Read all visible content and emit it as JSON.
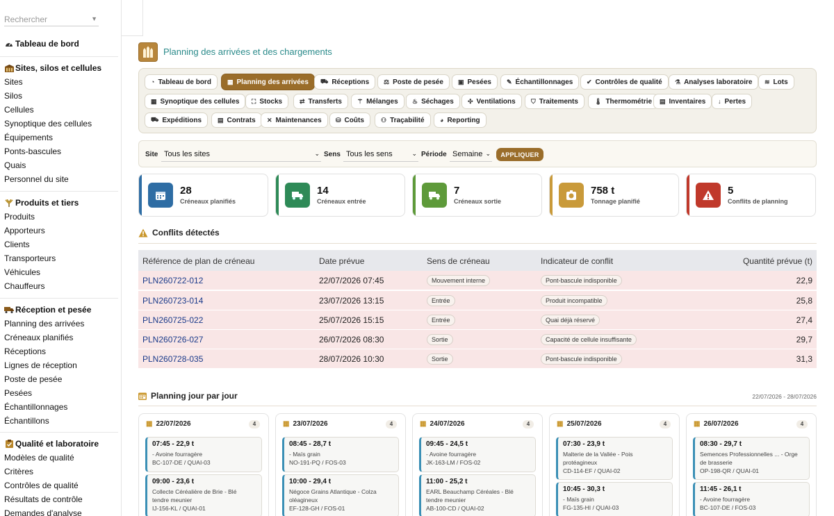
{
  "search": {
    "placeholder": "Rechercher"
  },
  "sidebar": {
    "sections": [
      {
        "title": "Tableau de bord",
        "items": []
      },
      {
        "title": "Sites, silos et cellules",
        "items": [
          "Sites",
          "Silos",
          "Cellules",
          "Synoptique des cellules",
          "Équipements",
          "Ponts-bascules",
          "Quais",
          "Personnel du site"
        ]
      },
      {
        "title": "Produits et tiers",
        "items": [
          "Produits",
          "Apporteurs",
          "Clients",
          "Transporteurs",
          "Véhicules",
          "Chauffeurs"
        ]
      },
      {
        "title": "Réception et pesée",
        "items": [
          "Planning des arrivées",
          "Créneaux planifiés",
          "Réceptions",
          "Lignes de réception",
          "Poste de pesée",
          "Pesées",
          "Échantillonnages",
          "Échantillons"
        ]
      },
      {
        "title": "Qualité et laboratoire",
        "items": [
          "Modèles de qualité",
          "Critères",
          "Contrôles de qualité",
          "Résultats de contrôle",
          "Demandes d'analyse"
        ]
      }
    ]
  },
  "page": {
    "title": "Planning des arrivées et des chargements"
  },
  "tabs": [
    {
      "label": "Tableau de bord",
      "icon": "gauge-icon"
    },
    {
      "label": "Planning des arrivées",
      "icon": "calendar-icon",
      "active": true
    },
    {
      "label": "Réceptions",
      "icon": "truck-icon"
    },
    {
      "label": "Poste de pesée",
      "icon": "scale-icon"
    },
    {
      "label": "Pesées",
      "icon": "weight-icon"
    },
    {
      "label": "Échantillonnages",
      "icon": "pipette-icon"
    },
    {
      "label": "Contrôles de qualité",
      "icon": "check-icon"
    },
    {
      "label": "Analyses laboratoire",
      "icon": "flask-icon"
    },
    {
      "label": "Lots",
      "icon": "layers-icon"
    },
    {
      "label": "Synoptique des cellules",
      "icon": "grid-icon"
    },
    {
      "label": "Stocks",
      "icon": "boxes-icon"
    },
    {
      "label": "Transferts",
      "icon": "shuffle-icon"
    },
    {
      "label": "Mélanges",
      "icon": "blend-icon"
    },
    {
      "label": "Séchages",
      "icon": "flame-icon"
    },
    {
      "label": "Ventilations",
      "icon": "fan-icon"
    },
    {
      "label": "Traitements",
      "icon": "shield-icon"
    },
    {
      "label": "Thermométrie",
      "icon": "thermometer-icon"
    },
    {
      "label": "Inventaires",
      "icon": "clipboard-icon"
    },
    {
      "label": "Pertes",
      "icon": "arrow-down-icon"
    },
    {
      "label": "Expéditions",
      "icon": "truck-out-icon"
    },
    {
      "label": "Contrats",
      "icon": "document-icon"
    },
    {
      "label": "Maintenances",
      "icon": "wrench-icon"
    },
    {
      "label": "Coûts",
      "icon": "coins-icon"
    },
    {
      "label": "Traçabilité",
      "icon": "network-icon"
    },
    {
      "label": "Reporting",
      "icon": "pie-icon"
    }
  ],
  "filters": {
    "site_label": "Site",
    "site_value": "Tous les sites",
    "sens_label": "Sens",
    "sens_value": "Tous les sens",
    "periode_label": "Période",
    "periode_value": "Semaine",
    "apply_label": "APPLIQUER"
  },
  "kpis": [
    {
      "value": "28",
      "label": "Créneaux planifiés",
      "color": "#2e6da4",
      "icon": "calendar-icon"
    },
    {
      "value": "14",
      "label": "Créneaux entrée",
      "color": "#2e8a57",
      "icon": "truck-in-icon"
    },
    {
      "value": "7",
      "label": "Créneaux sortie",
      "color": "#5e9a3a",
      "icon": "truck-out-icon"
    },
    {
      "value": "758 t",
      "label": "Tonnage planifié",
      "color": "#c99a3a",
      "icon": "weight-icon"
    },
    {
      "value": "5",
      "label": "Conflits de planning",
      "color": "#c0392b",
      "icon": "warning-icon"
    }
  ],
  "conflicts": {
    "title": "Conflits détectés",
    "columns": [
      "Référence de plan de créneau",
      "Date prévue",
      "Sens de créneau",
      "Indicateur de conflit",
      "Quantité prévue (t)"
    ],
    "rows": [
      {
        "ref": "PLN260722-012",
        "date": "22/07/2026 07:45",
        "sens": "Mouvement interne",
        "conflit": "Pont-bascule indisponible",
        "qty": "22,9"
      },
      {
        "ref": "PLN260723-014",
        "date": "23/07/2026 13:15",
        "sens": "Entrée",
        "conflit": "Produit incompatible",
        "qty": "25,8"
      },
      {
        "ref": "PLN260725-022",
        "date": "25/07/2026 15:15",
        "sens": "Entrée",
        "conflit": "Quai déjà réservé",
        "qty": "27,4"
      },
      {
        "ref": "PLN260726-027",
        "date": "26/07/2026 08:30",
        "sens": "Sortie",
        "conflit": "Capacité de cellule insuffisante",
        "qty": "29,7"
      },
      {
        "ref": "PLN260728-035",
        "date": "28/07/2026 10:30",
        "sens": "Sortie",
        "conflit": "Pont-bascule indisponible",
        "qty": "31,3"
      }
    ]
  },
  "planning": {
    "title": "Planning jour par jour",
    "range": "22/07/2026 - 28/07/2026",
    "days": [
      {
        "date": "22/07/2026",
        "count": "4",
        "slots": [
          {
            "time": "07:45 - 22,9 t",
            "lines": [
              "- Avoine fourragère",
              "BC-107-DE / QUAI-03"
            ]
          },
          {
            "time": "09:00 - 23,6 t",
            "lines": [
              "Collecte Céréalière de Brie - Blé",
              "tendre meunier",
              "IJ-156-KL / QUAI-01"
            ]
          }
        ]
      },
      {
        "date": "23/07/2026",
        "count": "4",
        "slots": [
          {
            "time": "08:45 - 28,7 t",
            "lines": [
              "- Maïs grain",
              "NO-191-PQ / FOS-03"
            ]
          },
          {
            "time": "10:00 - 29,4 t",
            "lines": [
              "Négoce Grains Atlantique - Colza",
              "oléagineux",
              "EF-128-GH / FOS-01"
            ]
          }
        ]
      },
      {
        "date": "24/07/2026",
        "count": "4",
        "slots": [
          {
            "time": "09:45 - 24,5 t",
            "lines": [
              "- Avoine fourragère",
              "JK-163-LM / FOS-02"
            ]
          },
          {
            "time": "11:00 - 25,2 t",
            "lines": [
              "EARL Beauchamp Céréales - Blé",
              "tendre meunier",
              "AB-100-CD / QUAI-02"
            ]
          }
        ]
      },
      {
        "date": "25/07/2026",
        "count": "4",
        "slots": [
          {
            "time": "07:30 - 23,9 t",
            "lines": [
              "Malterie de la Vallée - Pois",
              "protéagineux",
              "CD-114-EF / QUAI-02"
            ]
          },
          {
            "time": "10:45 - 30,3 t",
            "lines": [
              "- Maïs grain",
              "FG-135-HI / QUAI-03"
            ]
          }
        ]
      },
      {
        "date": "26/07/2026",
        "count": "4",
        "slots": [
          {
            "time": "08:30 - 29,7 t",
            "lines": [
              "Semences Professionnelles ... - Orge",
              "de brasserie",
              "OP-198-QR / QUAI-01"
            ]
          },
          {
            "time": "11:45 - 26,1 t",
            "lines": [
              "- Avoine fourragère",
              "BC-107-DE / FOS-03"
            ]
          }
        ]
      }
    ]
  }
}
